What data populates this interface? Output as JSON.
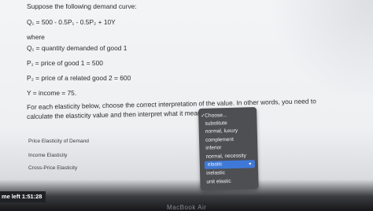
{
  "question": {
    "intro": "Suppose the following demand curve:",
    "equation": "Q₁ = 500 - 0.5P₁ - 0.5P₂ + 10Y",
    "where": "where",
    "definitions": [
      "Q₁ = quantity demanded of good 1",
      "P₁ = price of good 1 = 500",
      "P₂ = price of a related good 2 = 600",
      "Y = income = 75."
    ],
    "instruction_line1": "For each elasticity below, choose the correct interpretation of the value. In other words, you need to",
    "instruction_line2": "calculate the elasticity value and then interpret what it means."
  },
  "elasticities": [
    {
      "label": "Price Elasticity of Demand"
    },
    {
      "label": "Income Elasticity"
    },
    {
      "label": "Cross-Price Elasticity"
    }
  ],
  "dropdown": {
    "options": [
      {
        "label": "Choose...",
        "checked": true
      },
      {
        "label": "substitute"
      },
      {
        "label": "normal, luxury"
      },
      {
        "label": "complement"
      },
      {
        "label": "inferior"
      },
      {
        "label": "normal, necessity"
      },
      {
        "label": "elastic",
        "highlighted": true
      },
      {
        "label": "inelastic"
      },
      {
        "label": "unit elastic"
      }
    ],
    "check_glyph": "✓",
    "highlight_color": "#3f79d8",
    "menu_color": "#4e4f53"
  },
  "timer": {
    "text": "me left 1:51:28"
  },
  "device": {
    "label": "MacBook Air"
  }
}
